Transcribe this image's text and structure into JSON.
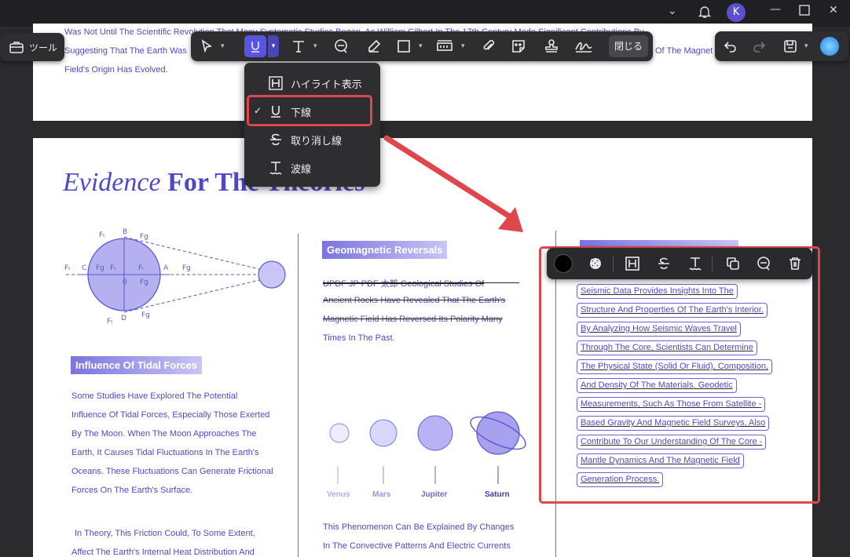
{
  "window": {
    "avatar_initial": "K"
  },
  "toolbar": {
    "tools_label": "ツール",
    "close_label": "閉じる"
  },
  "dropdown": {
    "items": [
      {
        "label": "ハイライト表示",
        "icon": "highlight-icon",
        "checked": false
      },
      {
        "label": "下線",
        "icon": "underline-icon",
        "checked": true
      },
      {
        "label": "取り消し線",
        "icon": "strikethrough-icon",
        "checked": false
      },
      {
        "label": "波線",
        "icon": "squiggly-icon",
        "checked": false
      }
    ],
    "check_mark": "✓"
  },
  "page1": {
    "lines": [
      "Was Not Until The Scientific Revolution That Many Systematic Studies Began. As William Gilbert In The 17th Century Made Significant Contributions By",
      "Suggesting That The Earth Was",
      "Of The Magnet",
      "Field's Origin Has Evolved."
    ]
  },
  "page2": {
    "title_italic": "Evidence",
    "title_bold": "For The Theories",
    "diagram_labels": {
      "ft_left": "Fₜ",
      "c": "C",
      "fg1": "F𝗀",
      "ft1": "Fₜ",
      "fr": "Fᵣ",
      "a": "A",
      "fg_right": "F𝗀",
      "zero": "0",
      "fg2": "F𝗀",
      "b": "B",
      "d": "D",
      "ft_top": "Fₜ",
      "fg_top": "F𝗀",
      "ft_bot": "Fₜ",
      "fg_bot": "F𝗀"
    },
    "tidal": {
      "heading": "Influence Of Tidal Forces",
      "lines": [
        "Some Studies Have Explored The Potential",
        "Influence Of Tidal Forces, Especially Those Exerted",
        "By The Moon. When The Moon Approaches The",
        "Earth, It Causes Tidal Fluctuations In The Earth's",
        "Oceans. These Fluctuations Can Generate Frictional",
        "Forces On The Earth's Surface."
      ],
      "lines2": [
        "In Theory, This Friction Could, To Some Extent,",
        "Affect The Earth's Internal Heat Distribution And"
      ]
    },
    "geomagnetic": {
      "heading": "Geomagnetic Reversals",
      "lines": [
        "UPDF JP PDF 太郎 Geological Studies Of",
        "Ancient Rocks Have Revealed That The Earth's",
        "Magnetic Field Has Reversed Its Polarity Many",
        "Times In The Past."
      ],
      "planets": [
        "Venus",
        "Mars",
        "Jupiter",
        "Saturn"
      ],
      "bottom_lines": [
        "This Phenomenon Can Be Explained By Changes",
        "In The Convective Patterns And Electric Currents"
      ]
    },
    "selected_lines": [
      "Seismic Data Provides Insights Into The",
      "Structure And Properties Of The Earth's Interior.",
      "By Analyzing How Seismic Waves Travel",
      "Through The Core, Scientists Can Determine",
      "The Physical State (Solid Or Fluid), Composition,",
      "And Density Of The Materials. Geodetic",
      "Measurements, Such As Those From Satellite -",
      "Based Gravity And Magnetic Field Surveys, Also",
      "Contribute To Our Understanding Of The Core -",
      "Mantle Dynamics And The Magnetic Field",
      "Generation Process."
    ]
  },
  "colors": {
    "accent": "#4f49c8",
    "highlight_red": "#e0474c",
    "toolbar_bg": "#2e2e31"
  }
}
